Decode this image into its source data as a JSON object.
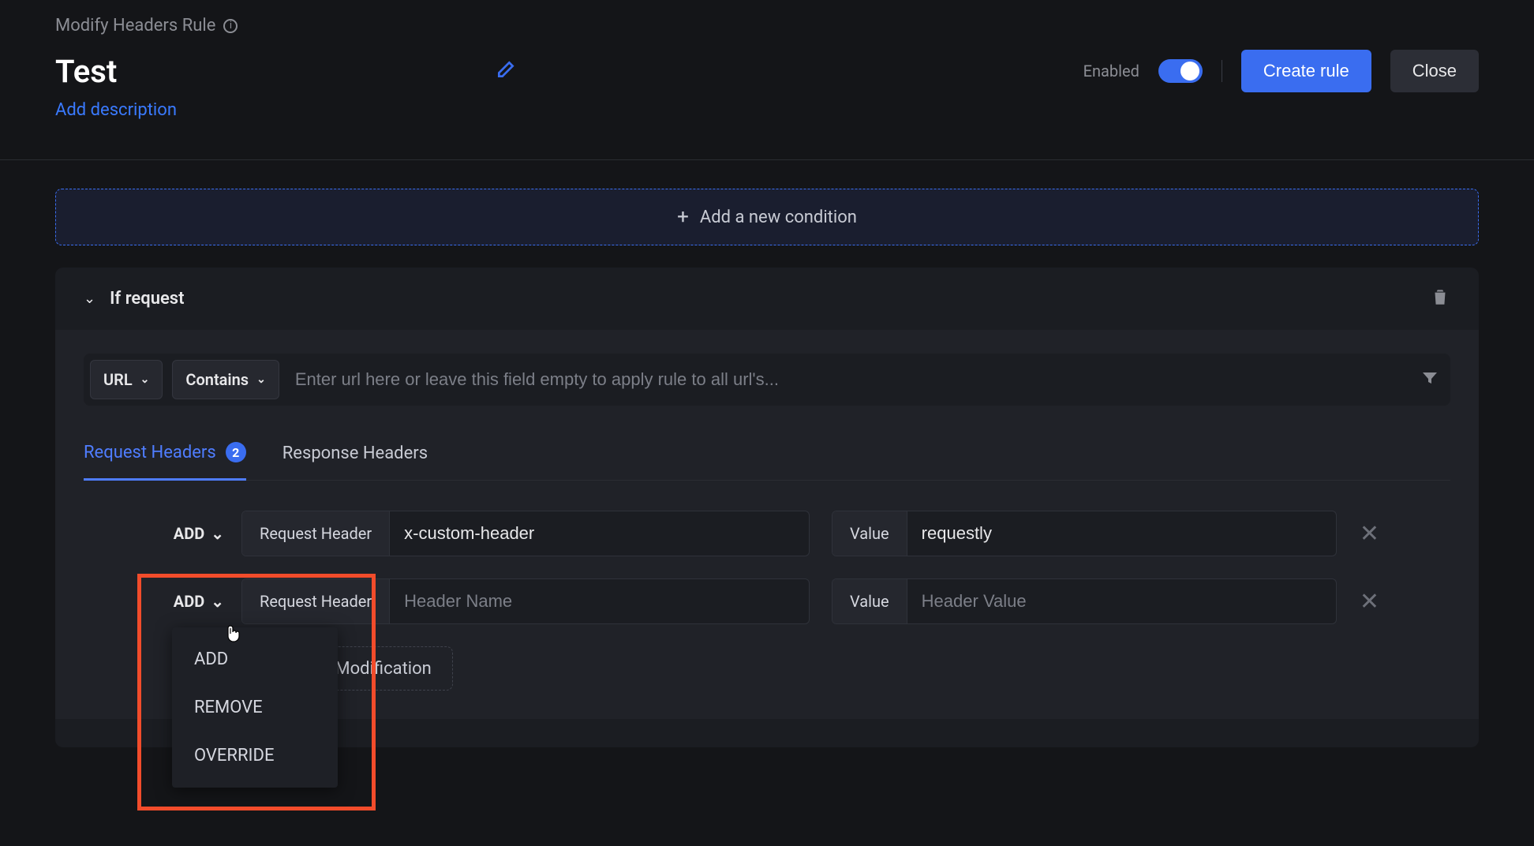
{
  "breadcrumb": {
    "title": "Modify Headers Rule"
  },
  "rule": {
    "name": "Test",
    "addDescription": "Add description",
    "enabledLabel": "Enabled",
    "createRule": "Create rule",
    "close": "Close"
  },
  "conditions": {
    "addCondition": "Add a new condition",
    "ifRequest": "If request",
    "matchTypeLabel": "URL",
    "operatorLabel": "Contains",
    "urlPlaceholder": "Enter url here or leave this field empty to apply rule to all url's..."
  },
  "tabs": {
    "request": {
      "label": "Request Headers",
      "count": "2"
    },
    "response": {
      "label": "Response Headers"
    }
  },
  "rows": [
    {
      "action": "ADD",
      "nameLabel": "Request Header",
      "name": "x-custom-header",
      "valueLabel": "Value",
      "value": "requestly"
    },
    {
      "action": "ADD",
      "nameLabel": "Request Header",
      "namePlaceholder": "Header Name",
      "valueLabel": "Value",
      "valuePlaceholder": "Header Value"
    }
  ],
  "dropdown": {
    "options": [
      "ADD",
      "REMOVE",
      "OVERRIDE"
    ]
  },
  "addModification": "Add Modification",
  "colors": {
    "accent": "#3a6df0",
    "highlight": "#f24c2b"
  }
}
